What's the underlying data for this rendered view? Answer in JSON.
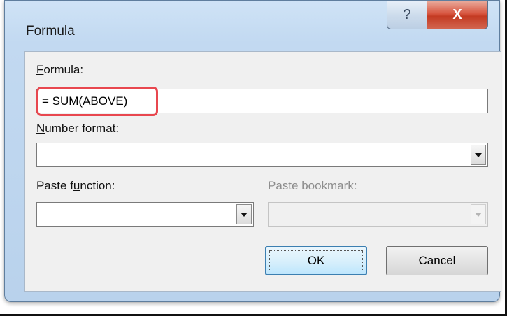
{
  "window": {
    "title": "Formula",
    "help_glyph": "?",
    "close_glyph": "X"
  },
  "formula": {
    "label_accel": "F",
    "label_rest": "ormula:",
    "value": "= SUM(ABOVE)"
  },
  "number_format": {
    "label_accel": "N",
    "label_rest": "umber format:",
    "value": ""
  },
  "paste_function": {
    "label_pre": "Paste f",
    "label_accel": "u",
    "label_post": "nction:",
    "value": ""
  },
  "paste_bookmark": {
    "label": "Paste bookmark:",
    "value": "",
    "enabled": false
  },
  "buttons": {
    "ok": "OK",
    "cancel": "Cancel"
  },
  "colors": {
    "highlight": "#e8474f",
    "close_button": "#c33a22",
    "title_bar": "#c2d9f1"
  }
}
